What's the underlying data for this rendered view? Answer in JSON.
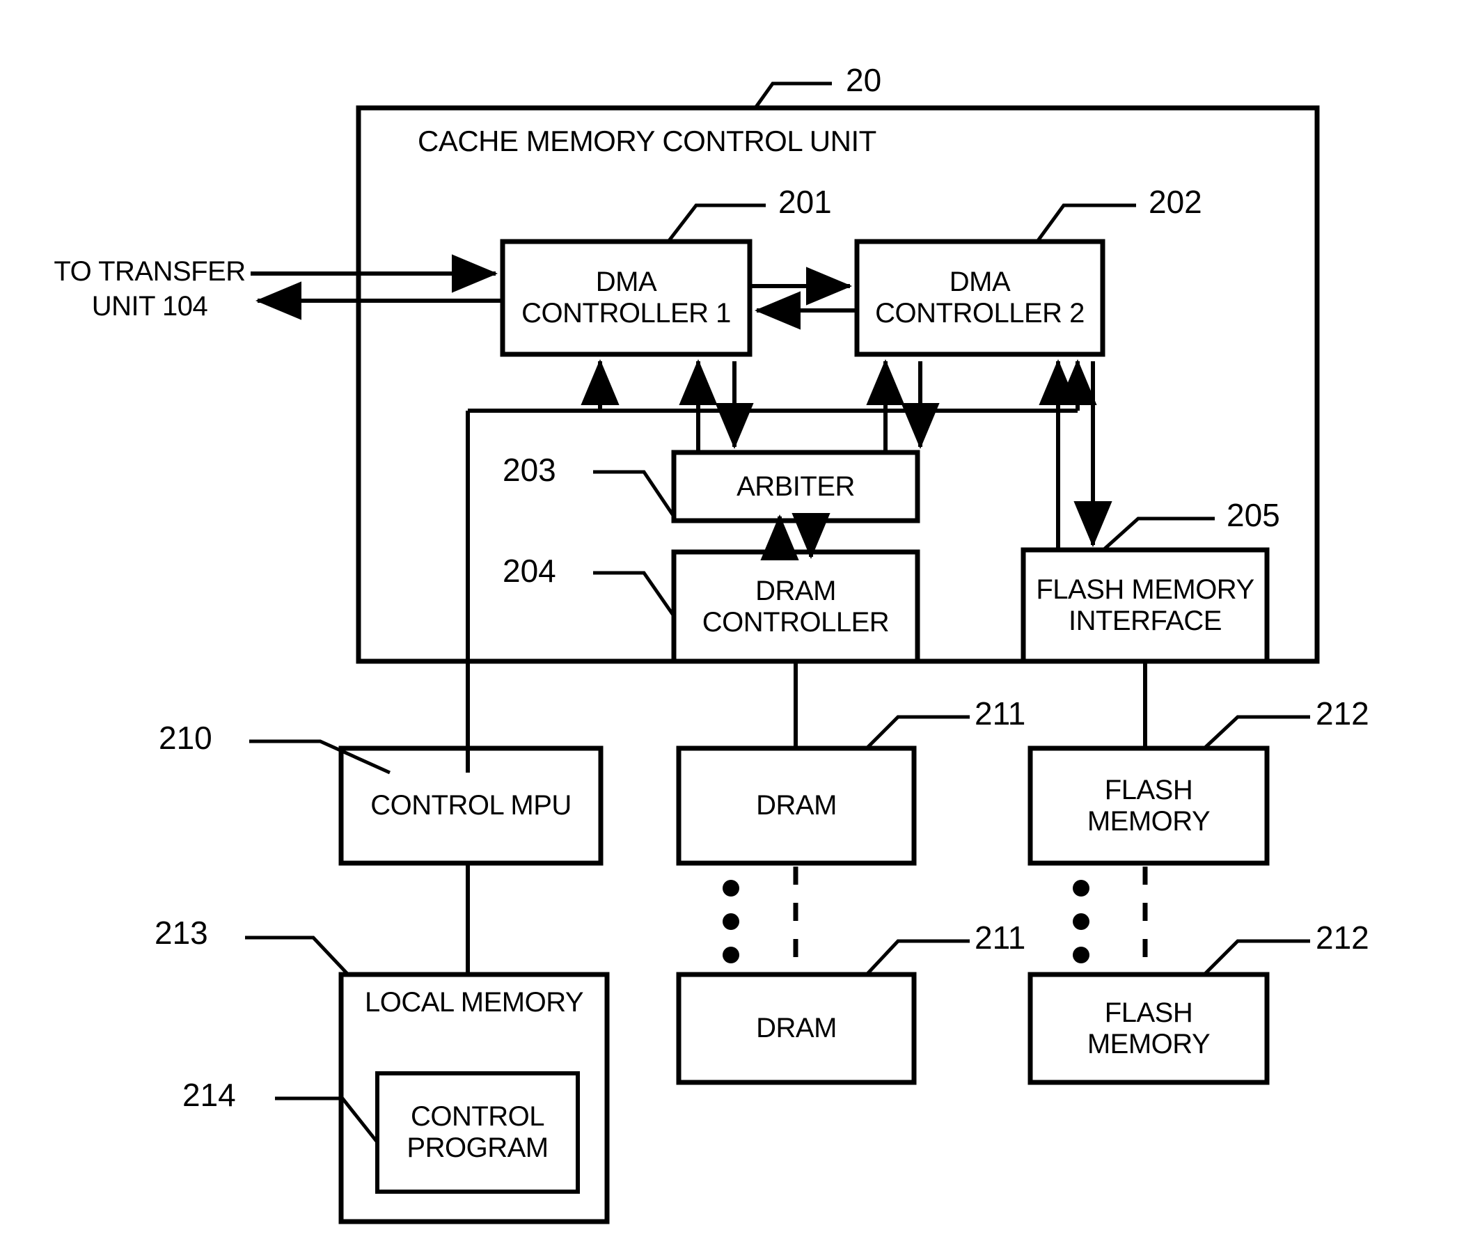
{
  "figure": {
    "type": "patent-block-diagram",
    "outer_unit": {
      "ref": "20",
      "title": "CACHE MEMORY CONTROL UNIT"
    },
    "external_label": {
      "line1": "TO TRANSFER",
      "line2": "UNIT 104"
    },
    "blocks": [
      {
        "id": "dma1",
        "ref": "201",
        "line1": "DMA",
        "line2": "CONTROLLER 1"
      },
      {
        "id": "dma2",
        "ref": "202",
        "line1": "DMA",
        "line2": "CONTROLLER 2"
      },
      {
        "id": "arbiter",
        "ref": "203",
        "line1": "ARBITER",
        "line2": ""
      },
      {
        "id": "dramctl",
        "ref": "204",
        "line1": "DRAM",
        "line2": "CONTROLLER"
      },
      {
        "id": "flashif",
        "ref": "205",
        "line1": "FLASH MEMORY",
        "line2": "INTERFACE"
      },
      {
        "id": "mpu",
        "ref": "210",
        "line1": "CONTROL MPU",
        "line2": ""
      },
      {
        "id": "dram_top",
        "ref": "211",
        "line1": "DRAM",
        "line2": ""
      },
      {
        "id": "dram_bot",
        "ref": "211",
        "line1": "DRAM",
        "line2": ""
      },
      {
        "id": "flash_top",
        "ref": "212",
        "line1": "FLASH",
        "line2": "MEMORY"
      },
      {
        "id": "flash_bot",
        "ref": "212",
        "line1": "FLASH",
        "line2": "MEMORY"
      },
      {
        "id": "localmem",
        "ref": "213",
        "line1": "LOCAL MEMORY",
        "line2": ""
      },
      {
        "id": "ctrlprog",
        "ref": "214",
        "line1": "CONTROL",
        "line2": "PROGRAM"
      }
    ],
    "colors": {
      "ink": "#000000",
      "paper": "#ffffff"
    }
  }
}
